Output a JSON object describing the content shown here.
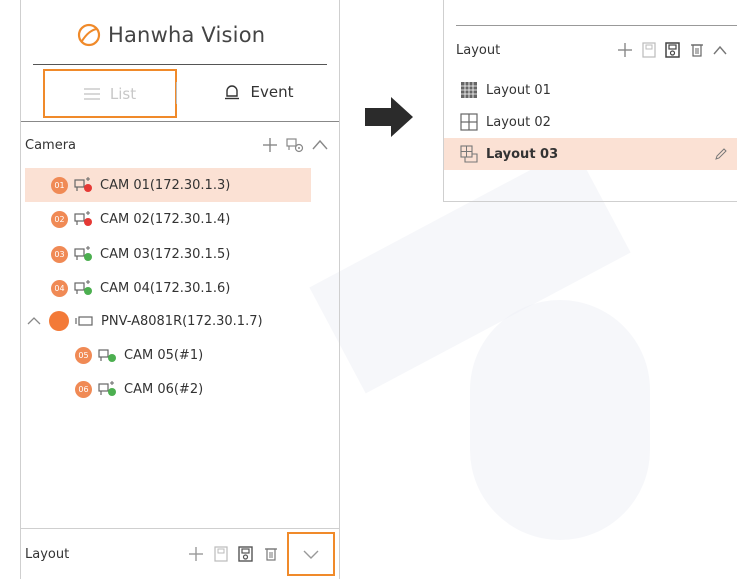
{
  "brand": {
    "name": "Hanwha Vision",
    "accent": "#f08a2a"
  },
  "left_panel": {
    "tabs": [
      {
        "label": "List",
        "icon": "list-icon",
        "highlighted": true
      },
      {
        "label": "Event",
        "icon": "bell-icon"
      }
    ],
    "camera_section": {
      "title": "Camera",
      "actions": [
        "plus-icon",
        "camera-settings-icon",
        "chevron-up-icon"
      ]
    },
    "cameras": [
      {
        "badge": "01",
        "label": "CAM 01(172.30.1.3)",
        "status": "red",
        "selected": true
      },
      {
        "badge": "02",
        "label": "CAM 02(172.30.1.4)",
        "status": "red"
      },
      {
        "badge": "03",
        "label": "CAM 03(172.30.1.5)",
        "status": "green"
      },
      {
        "badge": "04",
        "label": "CAM 04(172.30.1.6)",
        "status": "green"
      },
      {
        "badge": "",
        "label": "PNV-A8081R(172.30.1.7)",
        "status": "none",
        "expanded": true
      },
      {
        "badge": "05",
        "label": "CAM 05(#1)",
        "status": "green"
      },
      {
        "badge": "06",
        "label": "CAM 06(#2)",
        "status": "green"
      }
    ],
    "layout_bar": {
      "title": "Layout",
      "actions": [
        "plus-icon",
        "save-icon",
        "save-as-icon",
        "trash-icon",
        "chevron-down-icon"
      ]
    }
  },
  "right_panel": {
    "title": "Layout",
    "actions": [
      "plus-icon",
      "save-icon",
      "save-as-icon",
      "trash-icon",
      "chevron-up-icon"
    ],
    "layouts": [
      {
        "label": "Layout 01",
        "icon": "grid-dense-icon"
      },
      {
        "label": "Layout 02",
        "icon": "grid-quad-icon"
      },
      {
        "label": "Layout 03",
        "icon": "grid-custom-icon",
        "selected": true,
        "editable": true
      }
    ]
  },
  "colors": {
    "selected_bg": "#fbe1d4",
    "badge": "#f08a55",
    "status_red": "#e53935",
    "status_green": "#4caf50",
    "highlight_border": "#f08a2a"
  }
}
